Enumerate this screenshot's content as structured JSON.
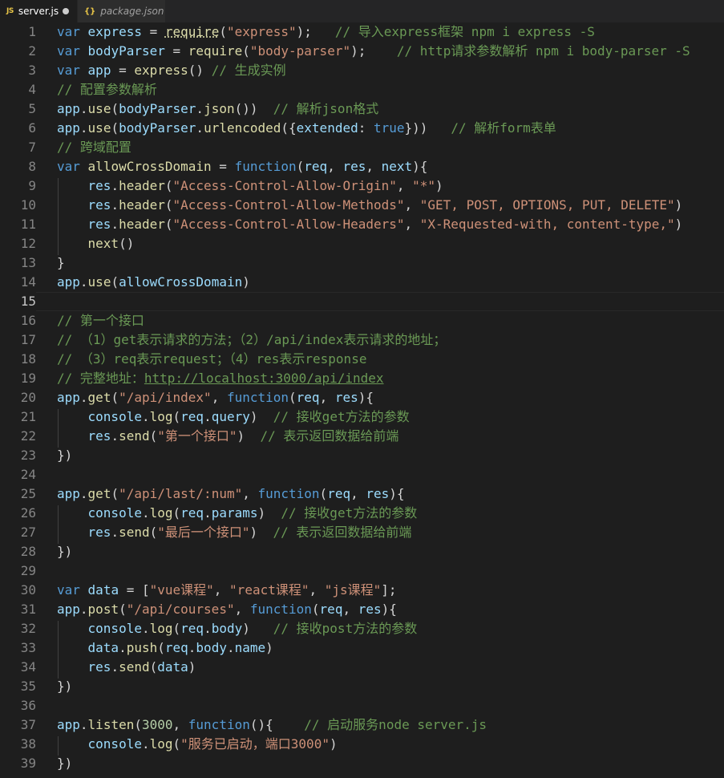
{
  "tabs": [
    {
      "label": "server.js",
      "icon": "js-file-icon",
      "icon_text": "JS",
      "active": true,
      "dirty": true
    },
    {
      "label": "package.json",
      "icon": "json-file-icon",
      "icon_text": "{}",
      "active": false,
      "dirty": false
    }
  ],
  "editor": {
    "current_line": 15,
    "lines": [
      {
        "n": "1",
        "tokens": [
          [
            "kw",
            "var"
          ],
          [
            "op",
            " "
          ],
          [
            "var",
            "express"
          ],
          [
            "op",
            " = "
          ],
          [
            "fn",
            "require"
          ],
          [
            "op",
            "("
          ],
          [
            "str",
            "\"express\""
          ],
          [
            "op",
            ");   "
          ],
          [
            "cmt",
            "// 导入express框架 npm i express -S"
          ]
        ]
      },
      {
        "n": "2",
        "tokens": [
          [
            "kw",
            "var"
          ],
          [
            "op",
            " "
          ],
          [
            "var",
            "bodyParser"
          ],
          [
            "op",
            " = "
          ],
          [
            "fn",
            "require"
          ],
          [
            "op",
            "("
          ],
          [
            "str",
            "\"body-parser\""
          ],
          [
            "op",
            ");    "
          ],
          [
            "cmt",
            "// http请求参数解析 npm i body-parser -S"
          ]
        ]
      },
      {
        "n": "3",
        "tokens": [
          [
            "kw",
            "var"
          ],
          [
            "op",
            " "
          ],
          [
            "var",
            "app"
          ],
          [
            "op",
            " = "
          ],
          [
            "fn",
            "express"
          ],
          [
            "op",
            "() "
          ],
          [
            "cmt",
            "// 生成实例"
          ]
        ]
      },
      {
        "n": "4",
        "tokens": [
          [
            "cmt",
            "// 配置参数解析"
          ]
        ]
      },
      {
        "n": "5",
        "tokens": [
          [
            "var",
            "app"
          ],
          [
            "op",
            "."
          ],
          [
            "fn",
            "use"
          ],
          [
            "op",
            "("
          ],
          [
            "var",
            "bodyParser"
          ],
          [
            "op",
            "."
          ],
          [
            "fn",
            "json"
          ],
          [
            "op",
            "())  "
          ],
          [
            "cmt",
            "// 解析json格式"
          ]
        ]
      },
      {
        "n": "6",
        "tokens": [
          [
            "var",
            "app"
          ],
          [
            "op",
            "."
          ],
          [
            "fn",
            "use"
          ],
          [
            "op",
            "("
          ],
          [
            "var",
            "bodyParser"
          ],
          [
            "op",
            "."
          ],
          [
            "fn",
            "urlencoded"
          ],
          [
            "op",
            "({"
          ],
          [
            "var",
            "extended"
          ],
          [
            "op",
            ": "
          ],
          [
            "kw",
            "true"
          ],
          [
            "op",
            "}))   "
          ],
          [
            "cmt",
            "// 解析form表单"
          ]
        ]
      },
      {
        "n": "7",
        "tokens": [
          [
            "cmt",
            "// 跨域配置"
          ]
        ]
      },
      {
        "n": "8",
        "tokens": [
          [
            "kw",
            "var"
          ],
          [
            "op",
            " "
          ],
          [
            "fn",
            "allowCrossDomain"
          ],
          [
            "op",
            " = "
          ],
          [
            "kw",
            "function"
          ],
          [
            "op",
            "("
          ],
          [
            "var",
            "req"
          ],
          [
            "op",
            ", "
          ],
          [
            "var",
            "res"
          ],
          [
            "op",
            ", "
          ],
          [
            "var",
            "next"
          ],
          [
            "op",
            "){"
          ]
        ]
      },
      {
        "n": "9",
        "tokens": [
          [
            "op",
            "    "
          ],
          [
            "var",
            "res"
          ],
          [
            "op",
            "."
          ],
          [
            "fn",
            "header"
          ],
          [
            "op",
            "("
          ],
          [
            "str",
            "\"Access-Control-Allow-Origin\""
          ],
          [
            "op",
            ", "
          ],
          [
            "str",
            "\"*\""
          ],
          [
            "op",
            ")"
          ]
        ]
      },
      {
        "n": "10",
        "tokens": [
          [
            "op",
            "    "
          ],
          [
            "var",
            "res"
          ],
          [
            "op",
            "."
          ],
          [
            "fn",
            "header"
          ],
          [
            "op",
            "("
          ],
          [
            "str",
            "\"Access-Control-Allow-Methods\""
          ],
          [
            "op",
            ", "
          ],
          [
            "str",
            "\"GET, POST, OPTIONS, PUT, DELETE\""
          ],
          [
            "op",
            ")"
          ]
        ]
      },
      {
        "n": "11",
        "tokens": [
          [
            "op",
            "    "
          ],
          [
            "var",
            "res"
          ],
          [
            "op",
            "."
          ],
          [
            "fn",
            "header"
          ],
          [
            "op",
            "("
          ],
          [
            "str",
            "\"Access-Control-Allow-Headers\""
          ],
          [
            "op",
            ", "
          ],
          [
            "str",
            "\"X-Requested-with, content-type,\""
          ],
          [
            "op",
            ")"
          ]
        ]
      },
      {
        "n": "12",
        "tokens": [
          [
            "op",
            "    "
          ],
          [
            "fn",
            "next"
          ],
          [
            "op",
            "()"
          ]
        ]
      },
      {
        "n": "13",
        "tokens": [
          [
            "op",
            "}"
          ]
        ]
      },
      {
        "n": "14",
        "tokens": [
          [
            "var",
            "app"
          ],
          [
            "op",
            "."
          ],
          [
            "fn",
            "use"
          ],
          [
            "op",
            "("
          ],
          [
            "var",
            "allowCrossDomain"
          ],
          [
            "op",
            ")"
          ]
        ]
      },
      {
        "n": "15",
        "tokens": []
      },
      {
        "n": "16",
        "tokens": [
          [
            "cmt",
            "// 第一个接口"
          ]
        ]
      },
      {
        "n": "17",
        "tokens": [
          [
            "cmt",
            "// （1）get表示请求的方法；（2）/api/index表示请求的地址；"
          ]
        ]
      },
      {
        "n": "18",
        "tokens": [
          [
            "cmt",
            "// （3）req表示request；（4）res表示response"
          ]
        ]
      },
      {
        "n": "19",
        "tokens": [
          [
            "cmt",
            "// 完整地址："
          ],
          [
            "cmtlink",
            "http://localhost:3000/api/index"
          ]
        ]
      },
      {
        "n": "20",
        "tokens": [
          [
            "var",
            "app"
          ],
          [
            "op",
            "."
          ],
          [
            "fn",
            "get"
          ],
          [
            "op",
            "("
          ],
          [
            "str",
            "\"/api/index\""
          ],
          [
            "op",
            ", "
          ],
          [
            "kw",
            "function"
          ],
          [
            "op",
            "("
          ],
          [
            "var",
            "req"
          ],
          [
            "op",
            ", "
          ],
          [
            "var",
            "res"
          ],
          [
            "op",
            "){"
          ]
        ]
      },
      {
        "n": "21",
        "tokens": [
          [
            "op",
            "    "
          ],
          [
            "var",
            "console"
          ],
          [
            "op",
            "."
          ],
          [
            "fn",
            "log"
          ],
          [
            "op",
            "("
          ],
          [
            "var",
            "req"
          ],
          [
            "op",
            "."
          ],
          [
            "var",
            "query"
          ],
          [
            "op",
            ")  "
          ],
          [
            "cmt",
            "// 接收get方法的参数"
          ]
        ]
      },
      {
        "n": "22",
        "tokens": [
          [
            "op",
            "    "
          ],
          [
            "var",
            "res"
          ],
          [
            "op",
            "."
          ],
          [
            "fn",
            "send"
          ],
          [
            "op",
            "("
          ],
          [
            "str",
            "\"第一个接口\""
          ],
          [
            "op",
            ")  "
          ],
          [
            "cmt",
            "// 表示返回数据给前端"
          ]
        ]
      },
      {
        "n": "23",
        "tokens": [
          [
            "op",
            "})"
          ]
        ]
      },
      {
        "n": "24",
        "tokens": []
      },
      {
        "n": "25",
        "tokens": [
          [
            "var",
            "app"
          ],
          [
            "op",
            "."
          ],
          [
            "fn",
            "get"
          ],
          [
            "op",
            "("
          ],
          [
            "str",
            "\"/api/last/:num\""
          ],
          [
            "op",
            ", "
          ],
          [
            "kw",
            "function"
          ],
          [
            "op",
            "("
          ],
          [
            "var",
            "req"
          ],
          [
            "op",
            ", "
          ],
          [
            "var",
            "res"
          ],
          [
            "op",
            "){"
          ]
        ]
      },
      {
        "n": "26",
        "tokens": [
          [
            "op",
            "    "
          ],
          [
            "var",
            "console"
          ],
          [
            "op",
            "."
          ],
          [
            "fn",
            "log"
          ],
          [
            "op",
            "("
          ],
          [
            "var",
            "req"
          ],
          [
            "op",
            "."
          ],
          [
            "var",
            "params"
          ],
          [
            "op",
            ")  "
          ],
          [
            "cmt",
            "// 接收get方法的参数"
          ]
        ]
      },
      {
        "n": "27",
        "tokens": [
          [
            "op",
            "    "
          ],
          [
            "var",
            "res"
          ],
          [
            "op",
            "."
          ],
          [
            "fn",
            "send"
          ],
          [
            "op",
            "("
          ],
          [
            "str",
            "\"最后一个接口\""
          ],
          [
            "op",
            ")  "
          ],
          [
            "cmt",
            "// 表示返回数据给前端"
          ]
        ]
      },
      {
        "n": "28",
        "tokens": [
          [
            "op",
            "})"
          ]
        ]
      },
      {
        "n": "29",
        "tokens": []
      },
      {
        "n": "30",
        "tokens": [
          [
            "kw",
            "var"
          ],
          [
            "op",
            " "
          ],
          [
            "var",
            "data"
          ],
          [
            "op",
            " = ["
          ],
          [
            "str",
            "\"vue课程\""
          ],
          [
            "op",
            ", "
          ],
          [
            "str",
            "\"react课程\""
          ],
          [
            "op",
            ", "
          ],
          [
            "str",
            "\"js课程\""
          ],
          [
            "op",
            "];"
          ]
        ]
      },
      {
        "n": "31",
        "tokens": [
          [
            "var",
            "app"
          ],
          [
            "op",
            "."
          ],
          [
            "fn",
            "post"
          ],
          [
            "op",
            "("
          ],
          [
            "str",
            "\"/api/courses\""
          ],
          [
            "op",
            ", "
          ],
          [
            "kw",
            "function"
          ],
          [
            "op",
            "("
          ],
          [
            "var",
            "req"
          ],
          [
            "op",
            ", "
          ],
          [
            "var",
            "res"
          ],
          [
            "op",
            "){"
          ]
        ]
      },
      {
        "n": "32",
        "tokens": [
          [
            "op",
            "    "
          ],
          [
            "var",
            "console"
          ],
          [
            "op",
            "."
          ],
          [
            "fn",
            "log"
          ],
          [
            "op",
            "("
          ],
          [
            "var",
            "req"
          ],
          [
            "op",
            "."
          ],
          [
            "var",
            "body"
          ],
          [
            "op",
            ")   "
          ],
          [
            "cmt",
            "// 接收post方法的参数"
          ]
        ]
      },
      {
        "n": "33",
        "tokens": [
          [
            "op",
            "    "
          ],
          [
            "var",
            "data"
          ],
          [
            "op",
            "."
          ],
          [
            "fn",
            "push"
          ],
          [
            "op",
            "("
          ],
          [
            "var",
            "req"
          ],
          [
            "op",
            "."
          ],
          [
            "var",
            "body"
          ],
          [
            "op",
            "."
          ],
          [
            "var",
            "name"
          ],
          [
            "op",
            ")"
          ]
        ]
      },
      {
        "n": "34",
        "tokens": [
          [
            "op",
            "    "
          ],
          [
            "var",
            "res"
          ],
          [
            "op",
            "."
          ],
          [
            "fn",
            "send"
          ],
          [
            "op",
            "("
          ],
          [
            "var",
            "data"
          ],
          [
            "op",
            ")"
          ]
        ]
      },
      {
        "n": "35",
        "tokens": [
          [
            "op",
            "})"
          ]
        ]
      },
      {
        "n": "36",
        "tokens": []
      },
      {
        "n": "37",
        "tokens": [
          [
            "var",
            "app"
          ],
          [
            "op",
            "."
          ],
          [
            "fn",
            "listen"
          ],
          [
            "op",
            "("
          ],
          [
            "num",
            "3000"
          ],
          [
            "op",
            ", "
          ],
          [
            "kw",
            "function"
          ],
          [
            "op",
            "(){    "
          ],
          [
            "cmt",
            "// 启动服务node server.js"
          ]
        ]
      },
      {
        "n": "38",
        "tokens": [
          [
            "op",
            "    "
          ],
          [
            "var",
            "console"
          ],
          [
            "op",
            "."
          ],
          [
            "fn",
            "log"
          ],
          [
            "op",
            "("
          ],
          [
            "str",
            "\"服务已启动，端口3000\""
          ],
          [
            "op",
            ")"
          ]
        ]
      },
      {
        "n": "39",
        "tokens": [
          [
            "op",
            "})"
          ]
        ]
      }
    ]
  },
  "colors": {
    "background": "#1e1e1e",
    "keyword": "#569cd6",
    "variable": "#9cdcfe",
    "function": "#dcdcaa",
    "string": "#ce9178",
    "comment": "#6a9955",
    "number": "#b5cea8",
    "line_number": "#858585"
  }
}
